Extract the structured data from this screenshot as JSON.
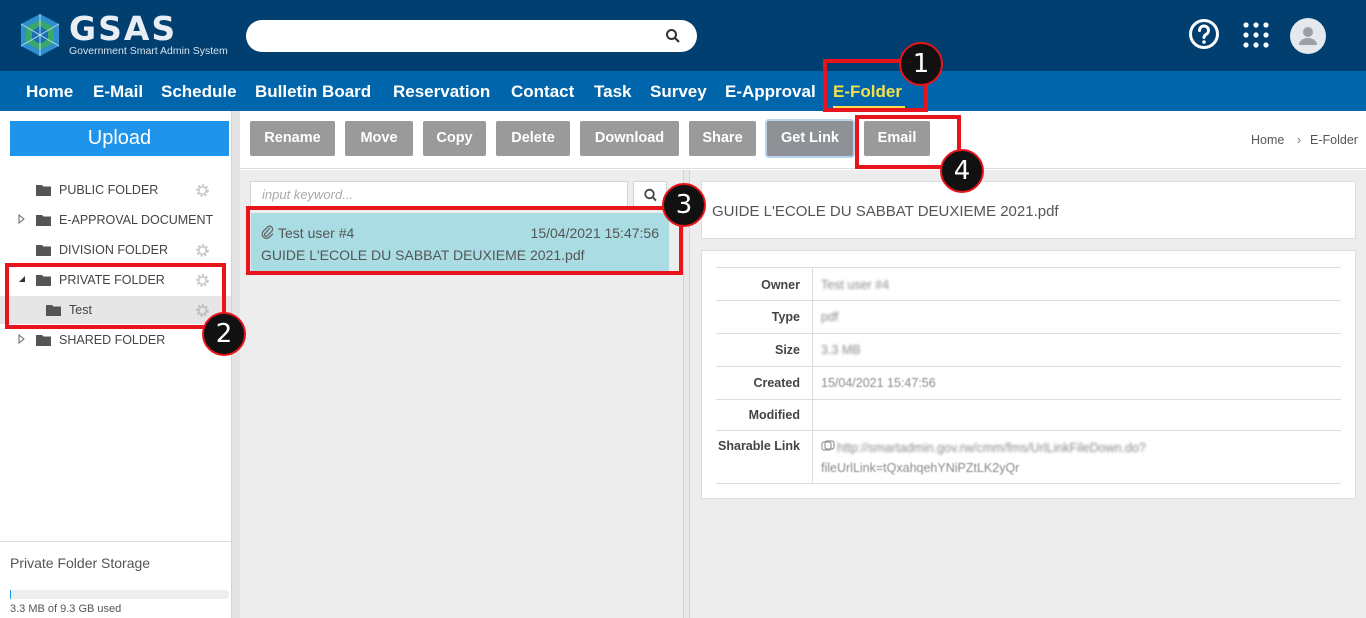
{
  "app": {
    "logo_text": "GSAS",
    "logo_subtitle": "Government Smart Admin System"
  },
  "search": {
    "placeholder": ""
  },
  "header_icons": [
    "help-icon",
    "apps-grid-icon",
    "user-avatar-icon"
  ],
  "nav": {
    "items": [
      "Home",
      "E-Mail",
      "Schedule",
      "Bulletin Board",
      "Reservation",
      "Contact",
      "Task",
      "Survey",
      "E-Approval",
      "E-Folder"
    ],
    "active": "E-Folder"
  },
  "sidebar": {
    "upload_label": "Upload",
    "tree": [
      {
        "label": "PUBLIC FOLDER",
        "has_gear": true,
        "toggle": ""
      },
      {
        "label": "E-APPROVAL DOCUMENT",
        "has_gear": false,
        "toggle": "collapsed"
      },
      {
        "label": "DIVISION FOLDER",
        "has_gear": true,
        "toggle": ""
      },
      {
        "label": "PRIVATE FOLDER",
        "has_gear": true,
        "toggle": "expanded"
      },
      {
        "label": "Test",
        "has_gear": true,
        "toggle": "",
        "selected": true
      },
      {
        "label": "SHARED FOLDER",
        "has_gear": false,
        "toggle": "collapsed"
      }
    ],
    "storage": {
      "title": "Private Folder Storage",
      "used_text": "3.3 MB of 9.3 GB used",
      "used_fraction": 0.0004
    }
  },
  "toolbar": {
    "buttons": [
      "Rename",
      "Move",
      "Copy",
      "Delete",
      "Download",
      "Share",
      "Get Link",
      "Email"
    ],
    "breadcrumb": [
      "Home",
      "E-Folder"
    ]
  },
  "file_list": {
    "keyword_placeholder": "input keyword...",
    "items": [
      {
        "user": "Test user #4",
        "date": "15/04/2021 15:47:56",
        "name": "GUIDE L'ECOLE DU SABBAT DEUXIEME 2021.pdf"
      }
    ]
  },
  "detail": {
    "title": "GUIDE L'ECOLE DU SABBAT DEUXIEME 2021.pdf",
    "rows": [
      {
        "label": "Owner",
        "value": "Test user #4"
      },
      {
        "label": "Type",
        "value": "pdf"
      },
      {
        "label": "Size",
        "value": "3.3 MB"
      },
      {
        "label": "Created",
        "value": "15/04/2021 15:47:56"
      },
      {
        "label": "Modified",
        "value": ""
      },
      {
        "label": "Sharable Link",
        "value_line1": "http://smartadmin.gov.rw/cmm/fms/UrlLinkFileDown.do?",
        "value_line2": "fileUrlLink=tQxahqehYNiPZtLK2yQr"
      }
    ]
  },
  "annotations": [
    "1",
    "2",
    "3",
    "4"
  ],
  "colors": {
    "header_bg": "#003f70",
    "nav_bg": "#0065ab",
    "active_nav": "#f5e04a",
    "upload_btn": "#1e95ea",
    "toolbar_btn": "#9a9a9a",
    "selected_file": "#a9dde3",
    "annotation_red": "#e8141b"
  }
}
